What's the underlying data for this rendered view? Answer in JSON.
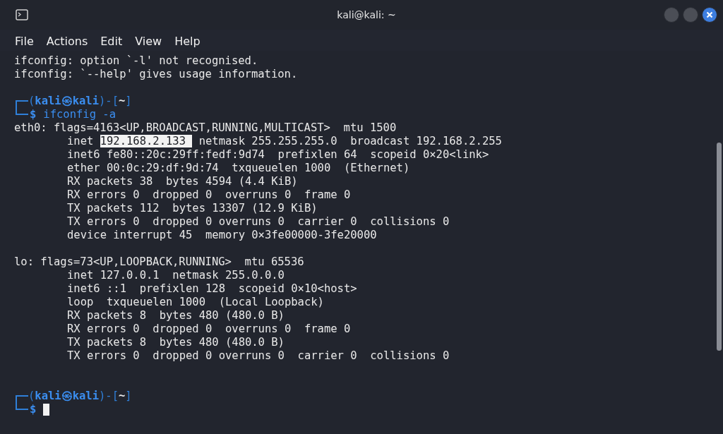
{
  "window": {
    "title": "kali@kali: ~"
  },
  "menu": [
    "File",
    "Actions",
    "Edit",
    "View",
    "Help"
  ],
  "terminal": {
    "lines": [
      {
        "kind": "output",
        "indented": false,
        "text": "ifconfig: option `-l' not recognised."
      },
      {
        "kind": "output",
        "indented": false,
        "text": "ifconfig: `--help' gives usage information."
      },
      {
        "kind": "blank"
      },
      {
        "kind": "prompt",
        "open": "(",
        "user": "kali",
        "mark": "㉿",
        "host": "kali",
        "sep": ")-[",
        "dir": "~",
        "close": "]",
        "sigil": "$",
        "command": "ifconfig -a",
        "cursor": false
      },
      {
        "kind": "output",
        "indented": false,
        "text": "eth0: flags=4163<UP,BROADCAST,RUNNING,MULTICAST>  mtu 1500"
      },
      {
        "kind": "selection",
        "indented": true,
        "before": "inet ",
        "selected": "192.168.2.133 ",
        "after": " netmask 255.255.255.0  broadcast 192.168.2.255"
      },
      {
        "kind": "output",
        "indented": true,
        "text": "inet6 fe80::20c:29ff:fedf:9d74  prefixlen 64  scopeid 0×20<link>"
      },
      {
        "kind": "output",
        "indented": true,
        "text": "ether 00:0c:29:df:9d:74  txqueuelen 1000  (Ethernet)"
      },
      {
        "kind": "output",
        "indented": true,
        "text": "RX packets 38  bytes 4594 (4.4 KiB)"
      },
      {
        "kind": "output",
        "indented": true,
        "text": "RX errors 0  dropped 0  overruns 0  frame 0"
      },
      {
        "kind": "output",
        "indented": true,
        "text": "TX packets 112  bytes 13307 (12.9 KiB)"
      },
      {
        "kind": "output",
        "indented": true,
        "text": "TX errors 0  dropped 0 overruns 0  carrier 0  collisions 0"
      },
      {
        "kind": "output",
        "indented": true,
        "text": "device interrupt 45  memory 0×3fe00000-3fe20000"
      },
      {
        "kind": "blank"
      },
      {
        "kind": "output",
        "indented": false,
        "text": "lo: flags=73<UP,LOOPBACK,RUNNING>  mtu 65536"
      },
      {
        "kind": "output",
        "indented": true,
        "text": "inet 127.0.0.1  netmask 255.0.0.0"
      },
      {
        "kind": "output",
        "indented": true,
        "text": "inet6 ::1  prefixlen 128  scopeid 0×10<host>"
      },
      {
        "kind": "output",
        "indented": true,
        "text": "loop  txqueuelen 1000  (Local Loopback)"
      },
      {
        "kind": "output",
        "indented": true,
        "text": "RX packets 8  bytes 480 (480.0 B)"
      },
      {
        "kind": "output",
        "indented": true,
        "text": "RX errors 0  dropped 0  overruns 0  frame 0"
      },
      {
        "kind": "output",
        "indented": true,
        "text": "TX packets 8  bytes 480 (480.0 B)"
      },
      {
        "kind": "output",
        "indented": true,
        "text": "TX errors 0  dropped 0 overruns 0  carrier 0  collisions 0"
      },
      {
        "kind": "blank"
      },
      {
        "kind": "blank"
      },
      {
        "kind": "prompt",
        "open": "(",
        "user": "kali",
        "mark": "㉿",
        "host": "kali",
        "sep": ")-[",
        "dir": "~",
        "close": "]",
        "sigil": "$",
        "cursor": true
      }
    ]
  }
}
